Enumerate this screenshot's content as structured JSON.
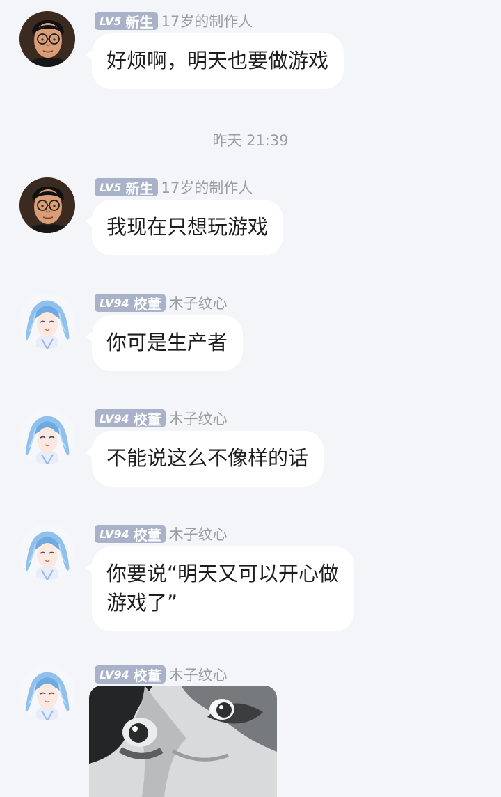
{
  "timestamp": "昨天 21:39",
  "messages": [
    {
      "badge_level": "LV5",
      "badge_title": "新生",
      "sender": "17岁的制作人",
      "text": "好烦啊，明天也要做游戏"
    },
    {
      "badge_level": "LV5",
      "badge_title": "新生",
      "sender": "17岁的制作人",
      "text": "我现在只想玩游戏"
    },
    {
      "badge_level": "LV94",
      "badge_title": "校董",
      "sender": "木子纹心",
      "text": "你可是生产者"
    },
    {
      "badge_level": "LV94",
      "badge_title": "校董",
      "sender": "木子纹心",
      "text": "不能说这么不像样的话"
    },
    {
      "badge_level": "LV94",
      "badge_title": "校董",
      "sender": "木子纹心",
      "text": "你要说“明天又可以开心做\n游戏了”"
    },
    {
      "badge_level": "LV94",
      "badge_title": "校董",
      "sender": "木子纹心",
      "image_description": "image-message"
    }
  ],
  "colors": {
    "background": "#f4f5f9",
    "bubble": "#ffffff",
    "badge": "#a9b2c9",
    "meta_text": "#9a9ca1",
    "message_text": "#1d1d1f"
  }
}
